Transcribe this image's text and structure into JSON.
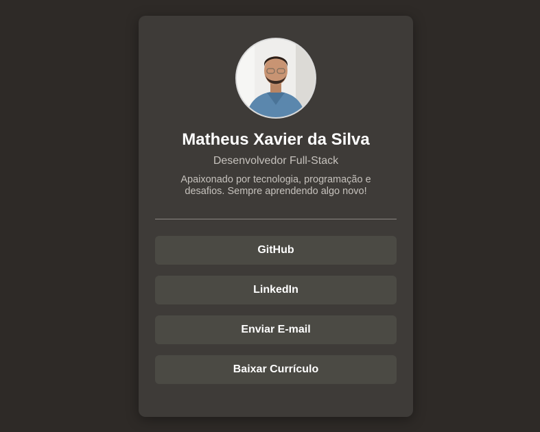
{
  "profile": {
    "avatar_icon": "profile-photo",
    "name": "Matheus Xavier da Silva",
    "role": "Desenvolvedor Full-Stack",
    "bio": "Apaixonado por tecnologia, programação e desafios. Sempre aprendendo algo novo!"
  },
  "links": [
    {
      "label": "GitHub"
    },
    {
      "label": "LinkedIn"
    },
    {
      "label": "Enviar E-mail"
    },
    {
      "label": "Baixar Currículo"
    }
  ],
  "colors": {
    "page_background": "#2e2a27",
    "card_background": "#3e3b38",
    "button_background": "#4b4a44",
    "text_primary": "#ffffff",
    "text_secondary": "#c6c2bd"
  }
}
